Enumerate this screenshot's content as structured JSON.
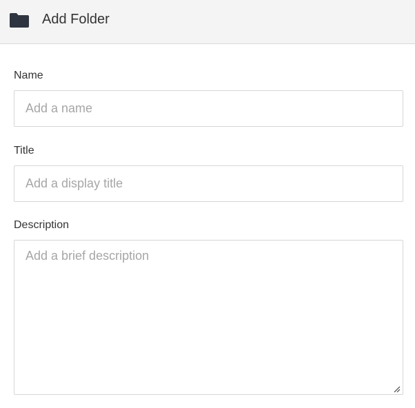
{
  "header": {
    "title": "Add Folder",
    "icon": "folder-icon"
  },
  "form": {
    "name": {
      "label": "Name",
      "value": "",
      "placeholder": "Add a name"
    },
    "title": {
      "label": "Title",
      "value": "",
      "placeholder": "Add a display title"
    },
    "description": {
      "label": "Description",
      "value": "",
      "placeholder": "Add a brief description"
    }
  },
  "colors": {
    "header_background": "#f4f4f4",
    "icon": "#2f3540",
    "text": "#333333",
    "placeholder": "#a6a6a6",
    "border": "#d6d6d6"
  }
}
